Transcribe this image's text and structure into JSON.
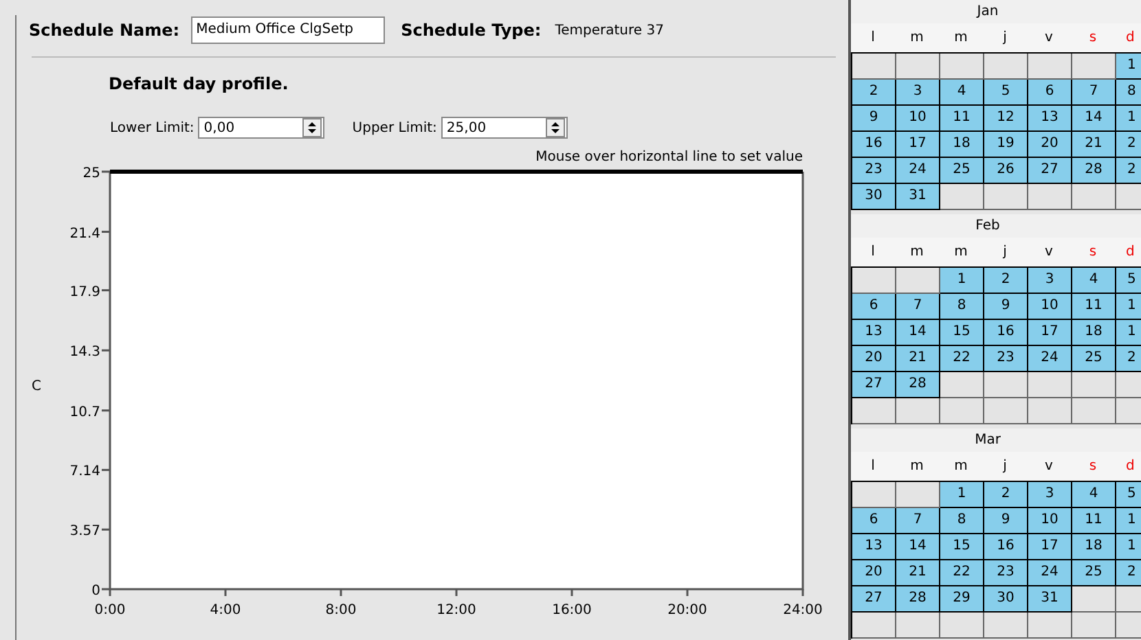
{
  "schedule": {
    "name_label": "Schedule Name:",
    "name_value": "Medium Office ClgSetp",
    "type_label": "Schedule Type:",
    "type_value": "Temperature 37"
  },
  "profile": {
    "title": "Default day profile.",
    "lower_limit": {
      "label": "Lower Limit:",
      "value": "0,00"
    },
    "upper_limit": {
      "label": "Upper Limit:",
      "value": "25,00"
    },
    "hint": "Mouse over horizontal line to set value",
    "chart_data": {
      "type": "line",
      "ylabel": "C",
      "x": [
        0,
        24
      ],
      "series": [
        {
          "color": "#000000",
          "values": [
            25,
            25
          ]
        }
      ],
      "xlim": [
        0,
        24
      ],
      "ylim": [
        0,
        25
      ],
      "xticks": [
        {
          "value": 0,
          "label": "0:00"
        },
        {
          "value": 4,
          "label": "4:00"
        },
        {
          "value": 8,
          "label": "8:00"
        },
        {
          "value": 12,
          "label": "12:00"
        },
        {
          "value": 16,
          "label": "16:00"
        },
        {
          "value": 20,
          "label": "20:00"
        },
        {
          "value": 24,
          "label": "24:00"
        }
      ],
      "yticks": [
        {
          "value": 0,
          "label": "0"
        },
        {
          "value": 3.57,
          "label": "3.57"
        },
        {
          "value": 7.14,
          "label": "7.14"
        },
        {
          "value": 10.7,
          "label": "10.7"
        },
        {
          "value": 14.3,
          "label": "14.3"
        },
        {
          "value": 17.9,
          "label": "17.9"
        },
        {
          "value": 21.4,
          "label": "21.4"
        },
        {
          "value": 25,
          "label": "25"
        }
      ]
    }
  },
  "months": [
    {
      "name": "Jan",
      "weekdays": [
        {
          "label": "l",
          "weekend": false
        },
        {
          "label": "m",
          "weekend": false
        },
        {
          "label": "m",
          "weekend": false
        },
        {
          "label": "j",
          "weekend": false
        },
        {
          "label": "v",
          "weekend": false
        },
        {
          "label": "s",
          "weekend": true
        },
        {
          "label": "d",
          "weekend": true
        }
      ],
      "weeks": [
        [
          {
            "selected": false
          },
          {
            "selected": false
          },
          {
            "selected": false
          },
          {
            "selected": false
          },
          {
            "selected": false
          },
          {
            "selected": false
          },
          {
            "day": "1",
            "selected": true
          }
        ],
        [
          {
            "day": "2",
            "selected": true
          },
          {
            "day": "3",
            "selected": true
          },
          {
            "day": "4",
            "selected": true
          },
          {
            "day": "5",
            "selected": true
          },
          {
            "day": "6",
            "selected": true
          },
          {
            "day": "7",
            "selected": true
          },
          {
            "day": "8",
            "selected": true
          }
        ],
        [
          {
            "day": "9",
            "selected": true
          },
          {
            "day": "10",
            "selected": true
          },
          {
            "day": "11",
            "selected": true
          },
          {
            "day": "12",
            "selected": true
          },
          {
            "day": "13",
            "selected": true
          },
          {
            "day": "14",
            "selected": true
          },
          {
            "day": "1",
            "selected": true
          }
        ],
        [
          {
            "day": "16",
            "selected": true
          },
          {
            "day": "17",
            "selected": true
          },
          {
            "day": "18",
            "selected": true
          },
          {
            "day": "19",
            "selected": true
          },
          {
            "day": "20",
            "selected": true
          },
          {
            "day": "21",
            "selected": true
          },
          {
            "day": "2",
            "selected": true
          }
        ],
        [
          {
            "day": "23",
            "selected": true
          },
          {
            "day": "24",
            "selected": true
          },
          {
            "day": "25",
            "selected": true
          },
          {
            "day": "26",
            "selected": true
          },
          {
            "day": "27",
            "selected": true
          },
          {
            "day": "28",
            "selected": true
          },
          {
            "day": "2",
            "selected": true
          }
        ],
        [
          {
            "day": "30",
            "selected": true
          },
          {
            "day": "31",
            "selected": true
          },
          {
            "selected": false
          },
          {
            "selected": false
          },
          {
            "selected": false
          },
          {
            "selected": false
          },
          {
            "selected": false
          }
        ]
      ]
    },
    {
      "name": "Feb",
      "weekdays": [
        {
          "label": "l",
          "weekend": false
        },
        {
          "label": "m",
          "weekend": false
        },
        {
          "label": "m",
          "weekend": false
        },
        {
          "label": "j",
          "weekend": false
        },
        {
          "label": "v",
          "weekend": false
        },
        {
          "label": "s",
          "weekend": true
        },
        {
          "label": "d",
          "weekend": true
        }
      ],
      "weeks": [
        [
          {
            "selected": false
          },
          {
            "selected": false
          },
          {
            "day": "1",
            "selected": true
          },
          {
            "day": "2",
            "selected": true
          },
          {
            "day": "3",
            "selected": true
          },
          {
            "day": "4",
            "selected": true
          },
          {
            "day": "5",
            "selected": true
          }
        ],
        [
          {
            "day": "6",
            "selected": true
          },
          {
            "day": "7",
            "selected": true
          },
          {
            "day": "8",
            "selected": true
          },
          {
            "day": "9",
            "selected": true
          },
          {
            "day": "10",
            "selected": true
          },
          {
            "day": "11",
            "selected": true
          },
          {
            "day": "1",
            "selected": true
          }
        ],
        [
          {
            "day": "13",
            "selected": true
          },
          {
            "day": "14",
            "selected": true
          },
          {
            "day": "15",
            "selected": true
          },
          {
            "day": "16",
            "selected": true
          },
          {
            "day": "17",
            "selected": true
          },
          {
            "day": "18",
            "selected": true
          },
          {
            "day": "1",
            "selected": true
          }
        ],
        [
          {
            "day": "20",
            "selected": true
          },
          {
            "day": "21",
            "selected": true
          },
          {
            "day": "22",
            "selected": true
          },
          {
            "day": "23",
            "selected": true
          },
          {
            "day": "24",
            "selected": true
          },
          {
            "day": "25",
            "selected": true
          },
          {
            "day": "2",
            "selected": true
          }
        ],
        [
          {
            "day": "27",
            "selected": true
          },
          {
            "day": "28",
            "selected": true
          },
          {
            "selected": false
          },
          {
            "selected": false
          },
          {
            "selected": false
          },
          {
            "selected": false
          },
          {
            "selected": false
          }
        ],
        [
          {
            "selected": false
          },
          {
            "selected": false
          },
          {
            "selected": false
          },
          {
            "selected": false
          },
          {
            "selected": false
          },
          {
            "selected": false
          },
          {
            "selected": false
          }
        ]
      ]
    },
    {
      "name": "Mar",
      "weekdays": [
        {
          "label": "l",
          "weekend": false
        },
        {
          "label": "m",
          "weekend": false
        },
        {
          "label": "m",
          "weekend": false
        },
        {
          "label": "j",
          "weekend": false
        },
        {
          "label": "v",
          "weekend": false
        },
        {
          "label": "s",
          "weekend": true
        },
        {
          "label": "d",
          "weekend": true
        }
      ],
      "weeks": [
        [
          {
            "selected": false
          },
          {
            "selected": false
          },
          {
            "day": "1",
            "selected": true
          },
          {
            "day": "2",
            "selected": true
          },
          {
            "day": "3",
            "selected": true
          },
          {
            "day": "4",
            "selected": true
          },
          {
            "day": "5",
            "selected": true
          }
        ],
        [
          {
            "day": "6",
            "selected": true
          },
          {
            "day": "7",
            "selected": true
          },
          {
            "day": "8",
            "selected": true
          },
          {
            "day": "9",
            "selected": true
          },
          {
            "day": "10",
            "selected": true
          },
          {
            "day": "11",
            "selected": true
          },
          {
            "day": "1",
            "selected": true
          }
        ],
        [
          {
            "day": "13",
            "selected": true
          },
          {
            "day": "14",
            "selected": true
          },
          {
            "day": "15",
            "selected": true
          },
          {
            "day": "16",
            "selected": true
          },
          {
            "day": "17",
            "selected": true
          },
          {
            "day": "18",
            "selected": true
          },
          {
            "day": "1",
            "selected": true
          }
        ],
        [
          {
            "day": "20",
            "selected": true
          },
          {
            "day": "21",
            "selected": true
          },
          {
            "day": "22",
            "selected": true
          },
          {
            "day": "23",
            "selected": true
          },
          {
            "day": "24",
            "selected": true
          },
          {
            "day": "25",
            "selected": true
          },
          {
            "day": "2",
            "selected": true
          }
        ],
        [
          {
            "day": "27",
            "selected": true
          },
          {
            "day": "28",
            "selected": true
          },
          {
            "day": "29",
            "selected": true
          },
          {
            "day": "30",
            "selected": true
          },
          {
            "day": "31",
            "selected": true
          },
          {
            "selected": false
          },
          {
            "selected": false
          }
        ],
        [
          {
            "selected": false
          },
          {
            "selected": false
          },
          {
            "selected": false
          },
          {
            "selected": false
          },
          {
            "selected": false
          },
          {
            "selected": false
          },
          {
            "selected": false
          }
        ]
      ]
    }
  ]
}
